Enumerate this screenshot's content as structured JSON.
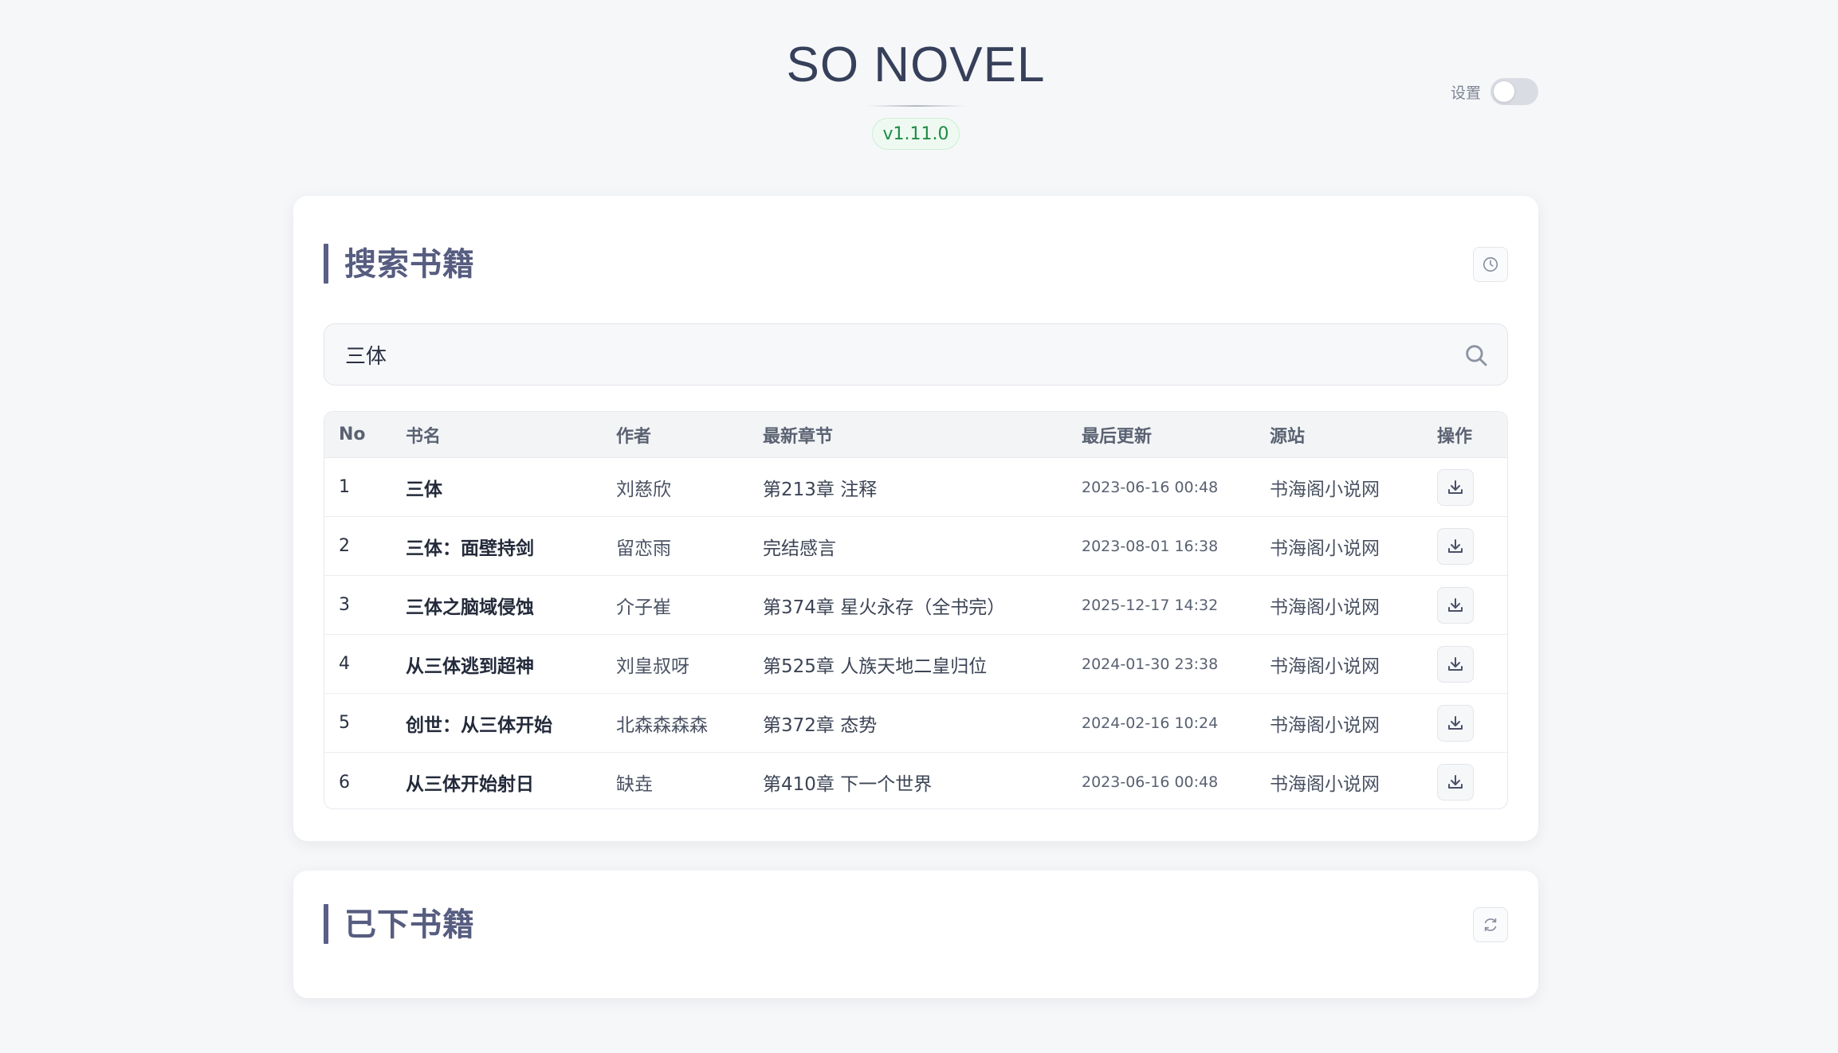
{
  "header": {
    "title": "SO NOVEL",
    "version": "v1.11.0",
    "settings_label": "设置",
    "settings_toggle_on": false
  },
  "search_section": {
    "title": "搜索书籍",
    "history_icon": "clock-icon",
    "search_value": "三体",
    "search_icon": "search-icon",
    "table": {
      "columns": [
        "No",
        "书名",
        "作者",
        "最新章节",
        "最后更新",
        "源站",
        "操作"
      ],
      "rows": [
        {
          "no": "1",
          "title": "三体",
          "author": "刘慈欣",
          "latest_chapter": "第213章 注释",
          "last_updated": "2023-06-16 00:48",
          "source": "书海阁小说网"
        },
        {
          "no": "2",
          "title": "三体：面壁持剑",
          "author": "留恋雨",
          "latest_chapter": "完结感言",
          "last_updated": "2023-08-01 16:38",
          "source": "书海阁小说网"
        },
        {
          "no": "3",
          "title": "三体之脑域侵蚀",
          "author": "介子崔",
          "latest_chapter": "第374章 星火永存（全书完）",
          "last_updated": "2025-12-17 14:32",
          "source": "书海阁小说网"
        },
        {
          "no": "4",
          "title": "从三体逃到超神",
          "author": "刘皇叔呀",
          "latest_chapter": "第525章 人族天地二皇归位",
          "last_updated": "2024-01-30 23:38",
          "source": "书海阁小说网"
        },
        {
          "no": "5",
          "title": "创世：从三体开始",
          "author": "北森森森森",
          "latest_chapter": "第372章 态势",
          "last_updated": "2024-02-16 10:24",
          "source": "书海阁小说网"
        },
        {
          "no": "6",
          "title": "从三体开始射日",
          "author": "缺垚",
          "latest_chapter": "第410章 下一个世界",
          "last_updated": "2023-06-16 00:48",
          "source": "书海阁小说网"
        }
      ],
      "action_icon": "download-icon"
    }
  },
  "downloaded_section": {
    "title": "已下书籍",
    "refresh_icon": "refresh-icon"
  },
  "colors": {
    "background": "#f6f7f9",
    "accent": "#5a5f85",
    "version_badge_text": "#1f8a45",
    "version_badge_bg": "#eefaf1"
  }
}
